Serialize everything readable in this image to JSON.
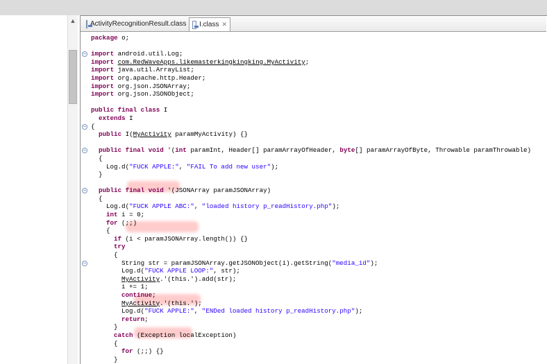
{
  "tabs": [
    {
      "label": "ActivityRecognitionResult.class",
      "icon": "class-file-icon",
      "active": false
    },
    {
      "label": "I.class",
      "icon": "class-file-icon",
      "active": true
    }
  ],
  "code_lines": [
    {
      "indent": 0,
      "parts": [
        {
          "t": "package",
          "c": "kw"
        },
        {
          "t": " o;"
        }
      ]
    },
    {
      "indent": 0,
      "parts": [
        {
          "t": ""
        }
      ]
    },
    {
      "indent": 0,
      "parts": [
        {
          "t": "import",
          "c": "kw"
        },
        {
          "t": " android.util.Log;"
        }
      ]
    },
    {
      "indent": 0,
      "parts": [
        {
          "t": "import",
          "c": "kw"
        },
        {
          "t": " "
        },
        {
          "t": "com.RedWaveApps.likemasterkingkingking.MyActivity",
          "c": "ul"
        },
        {
          "t": ";"
        }
      ]
    },
    {
      "indent": 0,
      "parts": [
        {
          "t": "import",
          "c": "kw"
        },
        {
          "t": " java.util.ArrayList;"
        }
      ]
    },
    {
      "indent": 0,
      "parts": [
        {
          "t": "import",
          "c": "kw"
        },
        {
          "t": " org.apache.http.Header;"
        }
      ]
    },
    {
      "indent": 0,
      "parts": [
        {
          "t": "import",
          "c": "kw"
        },
        {
          "t": " org.json.JSONArray;"
        }
      ]
    },
    {
      "indent": 0,
      "parts": [
        {
          "t": "import",
          "c": "kw"
        },
        {
          "t": " org.json.JSONObject;"
        }
      ]
    },
    {
      "indent": 0,
      "parts": [
        {
          "t": ""
        }
      ]
    },
    {
      "indent": 0,
      "parts": [
        {
          "t": "public final class",
          "c": "kw"
        },
        {
          "t": " I"
        }
      ]
    },
    {
      "indent": 1,
      "parts": [
        {
          "t": "extends",
          "c": "kw"
        },
        {
          "t": " I"
        }
      ]
    },
    {
      "indent": 0,
      "parts": [
        {
          "t": "{"
        }
      ]
    },
    {
      "indent": 1,
      "parts": [
        {
          "t": "public",
          "c": "kw"
        },
        {
          "t": " I("
        },
        {
          "t": "MyActivity",
          "c": "ul"
        },
        {
          "t": " paramMyActivity) {}"
        }
      ]
    },
    {
      "indent": 0,
      "parts": [
        {
          "t": ""
        }
      ]
    },
    {
      "indent": 1,
      "parts": [
        {
          "t": "public final void",
          "c": "kw"
        },
        {
          "t": " '("
        },
        {
          "t": "int",
          "c": "kw"
        },
        {
          "t": " paramInt, Header[] paramArrayOfHeader, "
        },
        {
          "t": "byte",
          "c": "kw"
        },
        {
          "t": "[] paramArrayOfByte, Throwable paramThrowable)"
        }
      ]
    },
    {
      "indent": 1,
      "parts": [
        {
          "t": "{"
        }
      ]
    },
    {
      "indent": 2,
      "parts": [
        {
          "t": "Log.d("
        },
        {
          "t": "\"FUCK APPLE:\"",
          "c": "str"
        },
        {
          "t": ", "
        },
        {
          "t": "\"FAIL To add new user\"",
          "c": "str"
        },
        {
          "t": ");"
        }
      ]
    },
    {
      "indent": 1,
      "parts": [
        {
          "t": "}"
        }
      ]
    },
    {
      "indent": 0,
      "parts": [
        {
          "t": ""
        }
      ]
    },
    {
      "indent": 1,
      "parts": [
        {
          "t": "public final void",
          "c": "kw"
        },
        {
          "t": " '(JSONArray paramJSONArray)"
        }
      ]
    },
    {
      "indent": 1,
      "parts": [
        {
          "t": "{"
        }
      ]
    },
    {
      "indent": 2,
      "parts": [
        {
          "t": "Log.d("
        },
        {
          "t": "\"FUCK APPLE ABC:\"",
          "c": "str"
        },
        {
          "t": ", "
        },
        {
          "t": "\"loaded history p_readHistory.php\"",
          "c": "str"
        },
        {
          "t": ");"
        }
      ]
    },
    {
      "indent": 2,
      "parts": [
        {
          "t": "int",
          "c": "kw"
        },
        {
          "t": " i = 0;"
        }
      ]
    },
    {
      "indent": 2,
      "parts": [
        {
          "t": "for",
          "c": "kw"
        },
        {
          "t": " (;;)"
        }
      ]
    },
    {
      "indent": 2,
      "parts": [
        {
          "t": "{"
        }
      ]
    },
    {
      "indent": 3,
      "parts": [
        {
          "t": "if",
          "c": "kw"
        },
        {
          "t": " (i < paramJSONArray.length()) {}"
        }
      ]
    },
    {
      "indent": 3,
      "parts": [
        {
          "t": "try",
          "c": "kw"
        }
      ]
    },
    {
      "indent": 3,
      "parts": [
        {
          "t": "{"
        }
      ]
    },
    {
      "indent": 4,
      "parts": [
        {
          "t": "String str = paramJSONArray.getJSONObject(i).getString("
        },
        {
          "t": "\"media_id\"",
          "c": "str"
        },
        {
          "t": ");"
        }
      ]
    },
    {
      "indent": 4,
      "parts": [
        {
          "t": "Log.d("
        },
        {
          "t": "\"FUCK APPLE LOOP:\"",
          "c": "str"
        },
        {
          "t": ", str);"
        }
      ]
    },
    {
      "indent": 4,
      "parts": [
        {
          "t": "MyActivity",
          "c": "ul"
        },
        {
          "t": ".'(this.').add(str);"
        }
      ]
    },
    {
      "indent": 4,
      "parts": [
        {
          "t": "i += 1;"
        }
      ]
    },
    {
      "indent": 4,
      "parts": [
        {
          "t": "continue",
          "c": "kw"
        },
        {
          "t": ";"
        }
      ]
    },
    {
      "indent": 4,
      "parts": [
        {
          "t": "MyActivity",
          "c": "ul"
        },
        {
          "t": ".'(this.');"
        }
      ]
    },
    {
      "indent": 4,
      "parts": [
        {
          "t": "Log.d("
        },
        {
          "t": "\"FUCK APPLE:\"",
          "c": "str"
        },
        {
          "t": ", "
        },
        {
          "t": "\"ENDed loaded history p_readHistory.php\"",
          "c": "str"
        },
        {
          "t": ");"
        }
      ]
    },
    {
      "indent": 4,
      "parts": [
        {
          "t": "return",
          "c": "kw"
        },
        {
          "t": ";"
        }
      ]
    },
    {
      "indent": 3,
      "parts": [
        {
          "t": "}"
        }
      ]
    },
    {
      "indent": 3,
      "parts": [
        {
          "t": "catch",
          "c": "kw"
        },
        {
          "t": " (Exception localException)"
        }
      ]
    },
    {
      "indent": 3,
      "parts": [
        {
          "t": "{"
        }
      ]
    },
    {
      "indent": 4,
      "parts": [
        {
          "t": "for",
          "c": "kw"
        },
        {
          "t": " (;;) {}"
        }
      ]
    },
    {
      "indent": 3,
      "parts": [
        {
          "t": "}"
        }
      ]
    }
  ],
  "fold_markers": [
    {
      "line": 2,
      "symbol": "−"
    },
    {
      "line": 11,
      "symbol": "−"
    },
    {
      "line": 14,
      "symbol": "−"
    },
    {
      "line": 19,
      "symbol": "−"
    },
    {
      "line": 28,
      "symbol": "−"
    }
  ],
  "colors": {
    "keyword": "#7f0055",
    "string": "#2a00ff",
    "highlight": "#ff8c8c"
  }
}
